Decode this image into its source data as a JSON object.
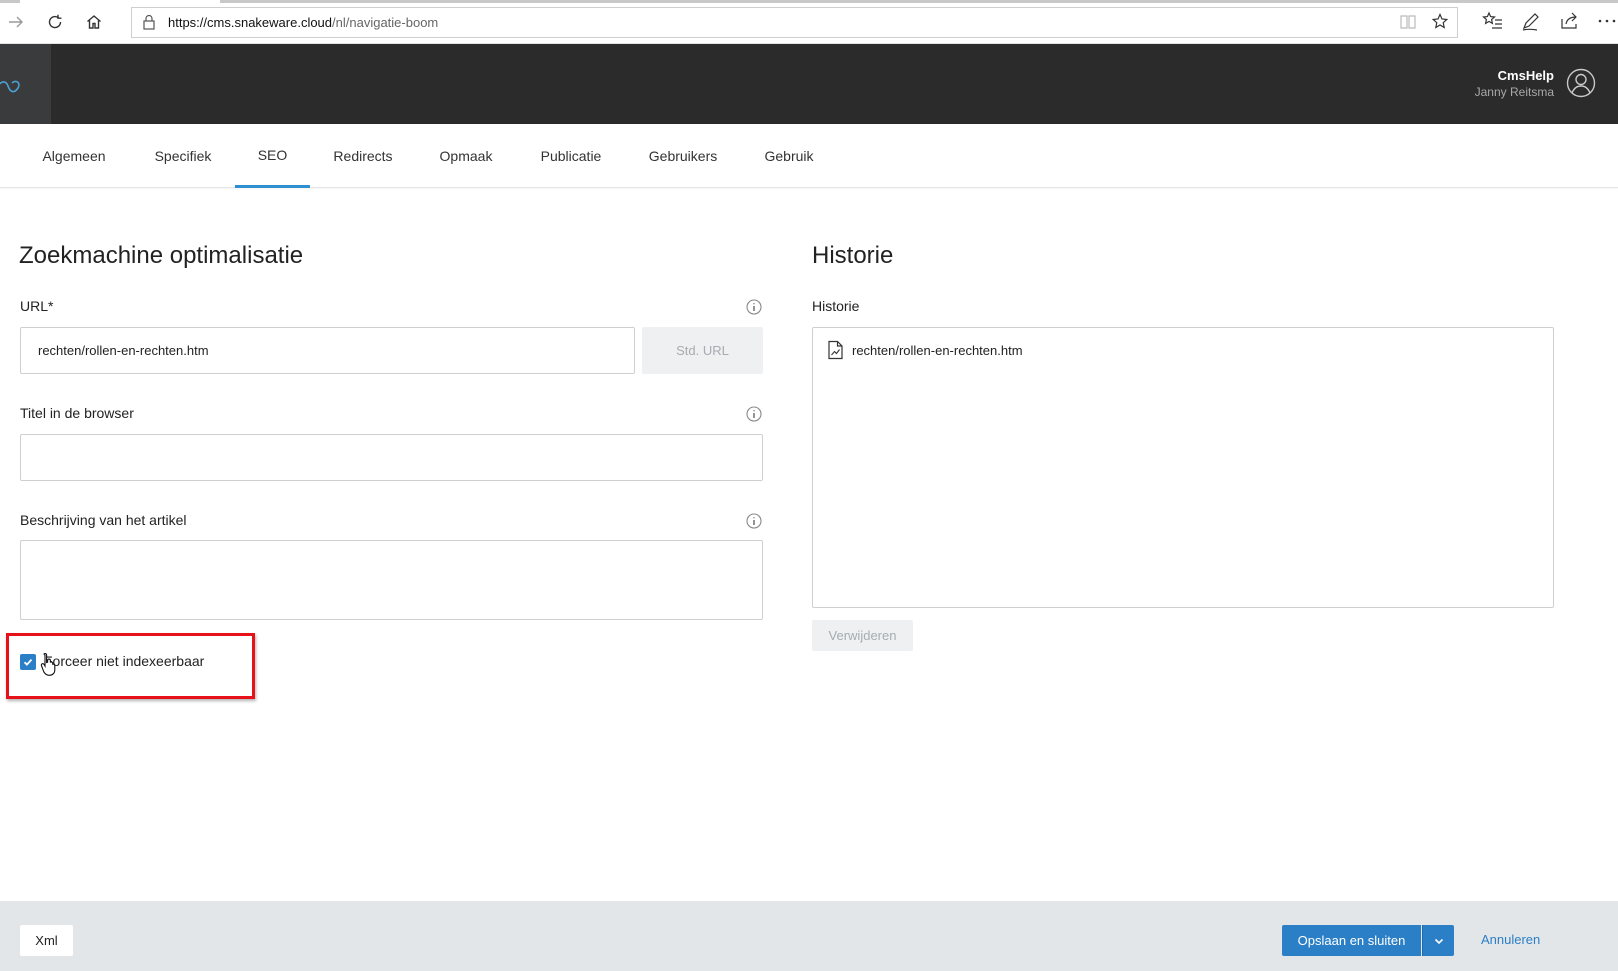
{
  "browser": {
    "url_host": "https://cms.snakeware.cloud",
    "url_path": "/nl/navigatie-boom"
  },
  "header": {
    "app_name": "CmsHelp",
    "user_name": "Janny Reitsma"
  },
  "tabs": [
    {
      "label": "Algemeen"
    },
    {
      "label": "Specifiek"
    },
    {
      "label": "SEO"
    },
    {
      "label": "Redirects"
    },
    {
      "label": "Opmaak"
    },
    {
      "label": "Publicatie"
    },
    {
      "label": "Gebruikers"
    },
    {
      "label": "Gebruik"
    }
  ],
  "active_tab": "SEO",
  "seo": {
    "title": "Zoekmachine optimalisatie",
    "url_label": "URL*",
    "url_value": "rechten/rollen-en-rechten.htm",
    "std_url_label": "Std. URL",
    "browser_title_label": "Titel in de browser",
    "browser_title_value": "",
    "description_label": "Beschrijving van het artikel",
    "description_value": "",
    "force_noindex_label": "Forceer niet indexeerbaar",
    "force_noindex_checked": true
  },
  "history": {
    "title": "Historie",
    "label": "Historie",
    "items": [
      "rechten/rollen-en-rechten.htm"
    ],
    "delete_label": "Verwijderen"
  },
  "footer": {
    "xml_label": "Xml",
    "save_label": "Opslaan en sluiten",
    "cancel_label": "Annuleren"
  },
  "colors": {
    "header_bg": "#2b2b2c",
    "accent": "#2b7fc6",
    "tab_underline": "#2f8fd0",
    "highlight": "#e8111a"
  }
}
